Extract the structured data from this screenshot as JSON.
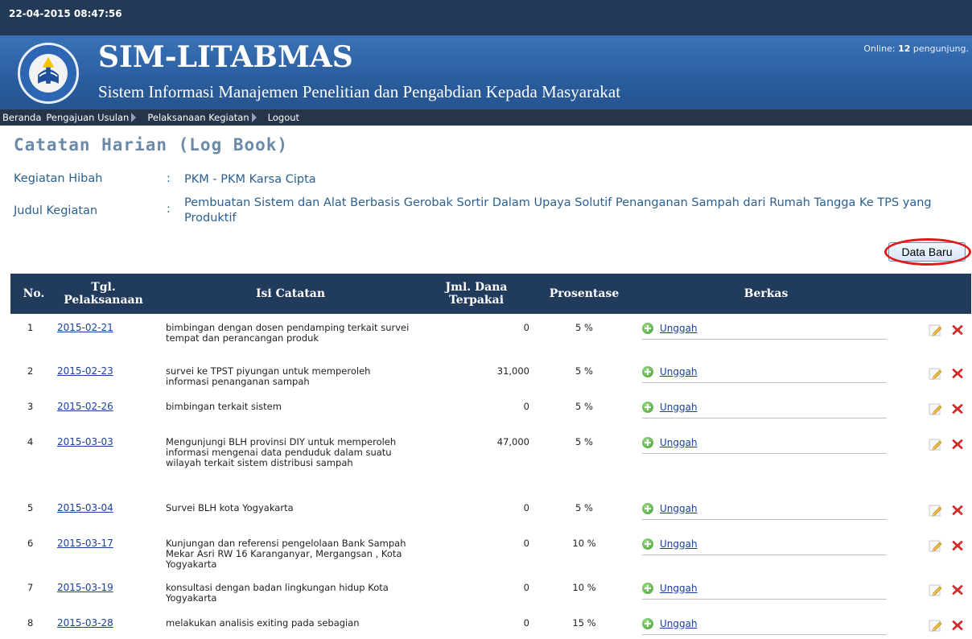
{
  "topbar": {
    "datetime": "22-04-2015  08:47:56"
  },
  "header": {
    "title": "SIM-LITABMAS",
    "subtitle": "Sistem Informasi Manajemen Penelitian dan Pengabdian Kepada Masyarakat",
    "online_prefix": "Online: ",
    "online_count": "12",
    "online_suffix": " pengunjung."
  },
  "nav": {
    "home": "Beranda",
    "proposal": "Pengajuan Usulan",
    "activity": "Pelaksanaan Kegiatan",
    "logout": "Logout"
  },
  "page": {
    "title": "Catatan Harian (Log Book)",
    "grant_label": "Kegiatan Hibah",
    "grant_value": "PKM - PKM Karsa Cipta",
    "activity_label": "Judul Kegiatan",
    "activity_value": "Pembuatan Sistem dan Alat Berbasis Gerobak Sortir Dalam Upaya Solutif Penanganan Sampah dari Rumah Tangga Ke TPS yang Produktif",
    "colon": ":",
    "new_button": "Data Baru"
  },
  "table": {
    "headers": {
      "no": "No.",
      "date": "Tgl. Pelaksanaan",
      "note": "Isi Catatan",
      "fund": "Jml. Dana Terpakai",
      "percent": "Prosentase",
      "file": "Berkas"
    },
    "upload_label": "Unggah",
    "rows": [
      {
        "no": "1",
        "date": "2015-02-21",
        "note": "bimbingan dengan dosen pendamping terkait survei tempat dan perancangan produk",
        "fund": "0",
        "percent": "5 %"
      },
      {
        "no": "2",
        "date": "2015-02-23",
        "note": "survei ke TPST piyungan untuk memperoleh informasi penanganan sampah",
        "fund": "31,000",
        "percent": "5 %"
      },
      {
        "no": "3",
        "date": "2015-02-26",
        "note": "bimbingan terkait sistem",
        "fund": "0",
        "percent": "5 %"
      },
      {
        "no": "4",
        "date": "2015-03-03",
        "note": "Mengunjungi BLH provinsi DIY untuk memperoleh informasi mengenai data penduduk dalam suatu wilayah terkait sistem distribusi sampah",
        "fund": "47,000",
        "percent": "5 %"
      },
      {
        "no": "5",
        "date": "2015-03-04",
        "note": "Survei BLH kota Yogyakarta",
        "fund": "0",
        "percent": "5 %"
      },
      {
        "no": "6",
        "date": "2015-03-17",
        "note": "Kunjungan dan referensi pengelolaan Bank Sampah Mekar Asri RW 16 Karanganyar, Mergangsan , Kota Yogyakarta",
        "fund": "0",
        "percent": "10 %"
      },
      {
        "no": "7",
        "date": "2015-03-19",
        "note": "konsultasi dengan badan lingkungan hidup Kota Yogyakarta",
        "fund": "0",
        "percent": "10 %"
      },
      {
        "no": "8",
        "date": "2015-03-28",
        "note": "melakukan analisis exiting pada sebagian",
        "fund": "0",
        "percent": "15 %"
      }
    ]
  }
}
